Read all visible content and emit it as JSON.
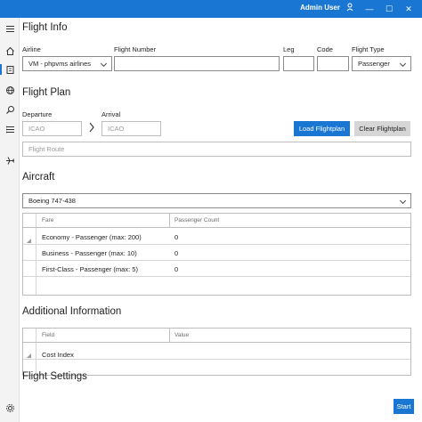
{
  "window": {
    "user": "Admin User",
    "controls": {
      "minimize": "—",
      "maximize": "☐",
      "close": "✕"
    }
  },
  "sidebar": {
    "items": [
      {
        "icon": "menu-icon"
      },
      {
        "icon": "home-icon"
      },
      {
        "icon": "flight-plan-icon",
        "active": true
      },
      {
        "icon": "globe-icon"
      },
      {
        "icon": "search-icon"
      },
      {
        "icon": "list-icon"
      },
      {
        "icon": "airplane-icon"
      },
      {
        "icon": "gear-icon"
      }
    ]
  },
  "flight_info": {
    "heading": "Flight Info",
    "airline_label": "Airline",
    "airline_value": "VM - phpvms airlines",
    "flight_number_label": "Flight Number",
    "flight_number_value": "",
    "leg_label": "Leg",
    "leg_value": "",
    "code_label": "Code",
    "code_value": "",
    "flight_type_label": "Flight Type",
    "flight_type_value": "Passenger"
  },
  "flight_plan": {
    "heading": "Flight Plan",
    "departure_label": "Departure",
    "departure_placeholder": "ICAO",
    "arrival_label": "Arrival",
    "arrival_placeholder": "ICAO",
    "load_button": "Load Flightplan",
    "clear_button": "Clear Flightplan",
    "route_placeholder": "Flight Route"
  },
  "aircraft": {
    "heading": "Aircraft",
    "selected": "Boeing 747-438",
    "fares_table": {
      "columns": [
        "Fare",
        "Passenger Count"
      ],
      "rows": [
        [
          "Economy - Passenger (max: 200)",
          "0"
        ],
        [
          "Business - Passenger (max: 10)",
          "0"
        ],
        [
          "First-Class - Passenger (max: 5)",
          "0"
        ]
      ]
    }
  },
  "additional_info": {
    "heading": "Additional Information",
    "table": {
      "columns": [
        "Field",
        "Value"
      ],
      "rows": [
        [
          "Cost Index",
          ""
        ]
      ]
    }
  },
  "flight_settings": {
    "heading": "Flight Settings"
  },
  "start_button": "Start",
  "colors": {
    "accent": "#1976d2",
    "sidebar": "#f3f3f3"
  }
}
